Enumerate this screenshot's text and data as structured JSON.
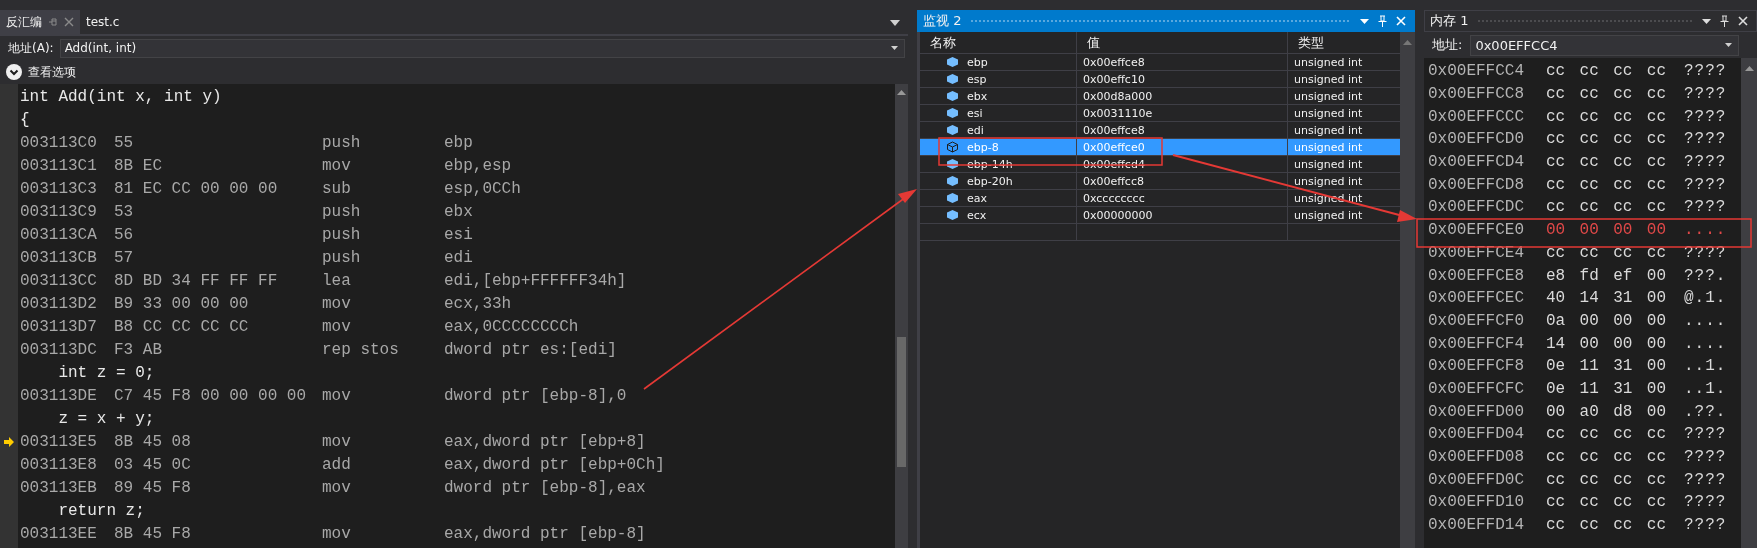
{
  "disassembly": {
    "tabs": [
      {
        "label": "反汇编",
        "selected": true
      },
      {
        "label": "test.c",
        "selected": false
      }
    ],
    "address_label": "地址(A):",
    "address_value": "Add(int, int)",
    "view_options": "查看选项",
    "lines": [
      {
        "kind": "source",
        "text": "int Add(int x, int y)"
      },
      {
        "kind": "source",
        "text": "{"
      },
      {
        "kind": "asm",
        "address": "003113C0",
        "bytes": "55",
        "mnemonic": "push",
        "operands": "ebp",
        "current": false
      },
      {
        "kind": "asm",
        "address": "003113C1",
        "bytes": "8B EC",
        "mnemonic": "mov",
        "operands": "ebp,esp",
        "current": false
      },
      {
        "kind": "asm",
        "address": "003113C3",
        "bytes": "81 EC CC 00 00 00",
        "mnemonic": "sub",
        "operands": "esp,0CCh",
        "current": false
      },
      {
        "kind": "asm",
        "address": "003113C9",
        "bytes": "53",
        "mnemonic": "push",
        "operands": "ebx",
        "current": false
      },
      {
        "kind": "asm",
        "address": "003113CA",
        "bytes": "56",
        "mnemonic": "push",
        "operands": "esi",
        "current": false
      },
      {
        "kind": "asm",
        "address": "003113CB",
        "bytes": "57",
        "mnemonic": "push",
        "operands": "edi",
        "current": false
      },
      {
        "kind": "asm",
        "address": "003113CC",
        "bytes": "8D BD 34 FF FF FF",
        "mnemonic": "lea",
        "operands": "edi,[ebp+FFFFFF34h]",
        "current": false
      },
      {
        "kind": "asm",
        "address": "003113D2",
        "bytes": "B9 33 00 00 00",
        "mnemonic": "mov",
        "operands": "ecx,33h",
        "current": false
      },
      {
        "kind": "asm",
        "address": "003113D7",
        "bytes": "B8 CC CC CC CC",
        "mnemonic": "mov",
        "operands": "eax,0CCCCCCCCh",
        "current": false
      },
      {
        "kind": "asm",
        "address": "003113DC",
        "bytes": "F3 AB",
        "mnemonic": "rep stos",
        "operands": "dword ptr es:[edi]",
        "current": false
      },
      {
        "kind": "source",
        "text": "    int z = 0;"
      },
      {
        "kind": "asm",
        "address": "003113DE",
        "bytes": "C7 45 F8 00 00 00 00",
        "mnemonic": "mov",
        "operands": "dword ptr [ebp-8],0",
        "current": false
      },
      {
        "kind": "source",
        "text": "    z = x + y;"
      },
      {
        "kind": "asm",
        "address": "003113E5",
        "bytes": "8B 45 08",
        "mnemonic": "mov",
        "operands": "eax,dword ptr [ebp+8]",
        "current": true
      },
      {
        "kind": "asm",
        "address": "003113E8",
        "bytes": "03 45 0C",
        "mnemonic": "add",
        "operands": "eax,dword ptr [ebp+0Ch]",
        "current": false
      },
      {
        "kind": "asm",
        "address": "003113EB",
        "bytes": "89 45 F8",
        "mnemonic": "mov",
        "operands": "dword ptr [ebp-8],eax",
        "current": false
      },
      {
        "kind": "source",
        "text": "    return z;"
      },
      {
        "kind": "asm",
        "address": "003113EE",
        "bytes": "8B 45 F8",
        "mnemonic": "mov",
        "operands": "eax,dword ptr [ebp-8]",
        "current": false
      }
    ]
  },
  "watch": {
    "title": "监视 2",
    "columns": [
      "名称",
      "值",
      "类型"
    ],
    "rows": [
      {
        "name": "ebp",
        "value": "0x00effce8",
        "type": "unsigned int",
        "selected": false
      },
      {
        "name": "esp",
        "value": "0x00effc10",
        "type": "unsigned int",
        "selected": false
      },
      {
        "name": "ebx",
        "value": "0x00d8a000",
        "type": "unsigned int",
        "selected": false
      },
      {
        "name": "esi",
        "value": "0x0031110e",
        "type": "unsigned int",
        "selected": false
      },
      {
        "name": "edi",
        "value": "0x00effce8",
        "type": "unsigned int",
        "selected": false
      },
      {
        "name": "ebp-8",
        "value": "0x00effce0",
        "type": "unsigned int",
        "selected": true
      },
      {
        "name": "ebp-14h",
        "value": "0x00effcd4",
        "type": "unsigned int",
        "selected": false
      },
      {
        "name": "ebp-20h",
        "value": "0x00effcc8",
        "type": "unsigned int",
        "selected": false
      },
      {
        "name": "eax",
        "value": "0xcccccccc",
        "type": "unsigned int",
        "selected": false
      },
      {
        "name": "ecx",
        "value": "0x00000000",
        "type": "unsigned int",
        "selected": false
      }
    ]
  },
  "memory": {
    "title": "内存 1",
    "address_label": "地址:",
    "address_value": "0x00EFFCC4",
    "rows": [
      {
        "address": "0x00EFFCC4",
        "bytes": "cc cc cc cc",
        "ascii": "????",
        "changed": false
      },
      {
        "address": "0x00EFFCC8",
        "bytes": "cc cc cc cc",
        "ascii": "????",
        "changed": false
      },
      {
        "address": "0x00EFFCCC",
        "bytes": "cc cc cc cc",
        "ascii": "????",
        "changed": false
      },
      {
        "address": "0x00EFFCD0",
        "bytes": "cc cc cc cc",
        "ascii": "????",
        "changed": false
      },
      {
        "address": "0x00EFFCD4",
        "bytes": "cc cc cc cc",
        "ascii": "????",
        "changed": false
      },
      {
        "address": "0x00EFFCD8",
        "bytes": "cc cc cc cc",
        "ascii": "????",
        "changed": false
      },
      {
        "address": "0x00EFFCDC",
        "bytes": "cc cc cc cc",
        "ascii": "????",
        "changed": false
      },
      {
        "address": "0x00EFFCE0",
        "bytes": "00 00 00 00",
        "ascii": "....",
        "changed": true
      },
      {
        "address": "0x00EFFCE4",
        "bytes": "cc cc cc cc",
        "ascii": "????",
        "changed": false
      },
      {
        "address": "0x00EFFCE8",
        "bytes": "e8 fd ef 00",
        "ascii": "???.",
        "changed": false
      },
      {
        "address": "0x00EFFCEC",
        "bytes": "40 14 31 00",
        "ascii": "@.1.",
        "changed": false
      },
      {
        "address": "0x00EFFCF0",
        "bytes": "0a 00 00 00",
        "ascii": "....",
        "changed": false
      },
      {
        "address": "0x00EFFCF4",
        "bytes": "14 00 00 00",
        "ascii": "....",
        "changed": false
      },
      {
        "address": "0x00EFFCF8",
        "bytes": "0e 11 31 00",
        "ascii": "..1.",
        "changed": false
      },
      {
        "address": "0x00EFFCFC",
        "bytes": "0e 11 31 00",
        "ascii": "..1.",
        "changed": false
      },
      {
        "address": "0x00EFFD00",
        "bytes": "00 a0 d8 00",
        "ascii": ".??.",
        "changed": false
      },
      {
        "address": "0x00EFFD04",
        "bytes": "cc cc cc cc",
        "ascii": "????",
        "changed": false
      },
      {
        "address": "0x00EFFD08",
        "bytes": "cc cc cc cc",
        "ascii": "????",
        "changed": false
      },
      {
        "address": "0x00EFFD0C",
        "bytes": "cc cc cc cc",
        "ascii": "????",
        "changed": false
      },
      {
        "address": "0x00EFFD10",
        "bytes": "cc cc cc cc",
        "ascii": "????",
        "changed": false
      },
      {
        "address": "0x00EFFD14",
        "bytes": "cc cc cc cc",
        "ascii": "????",
        "changed": false
      }
    ]
  }
}
